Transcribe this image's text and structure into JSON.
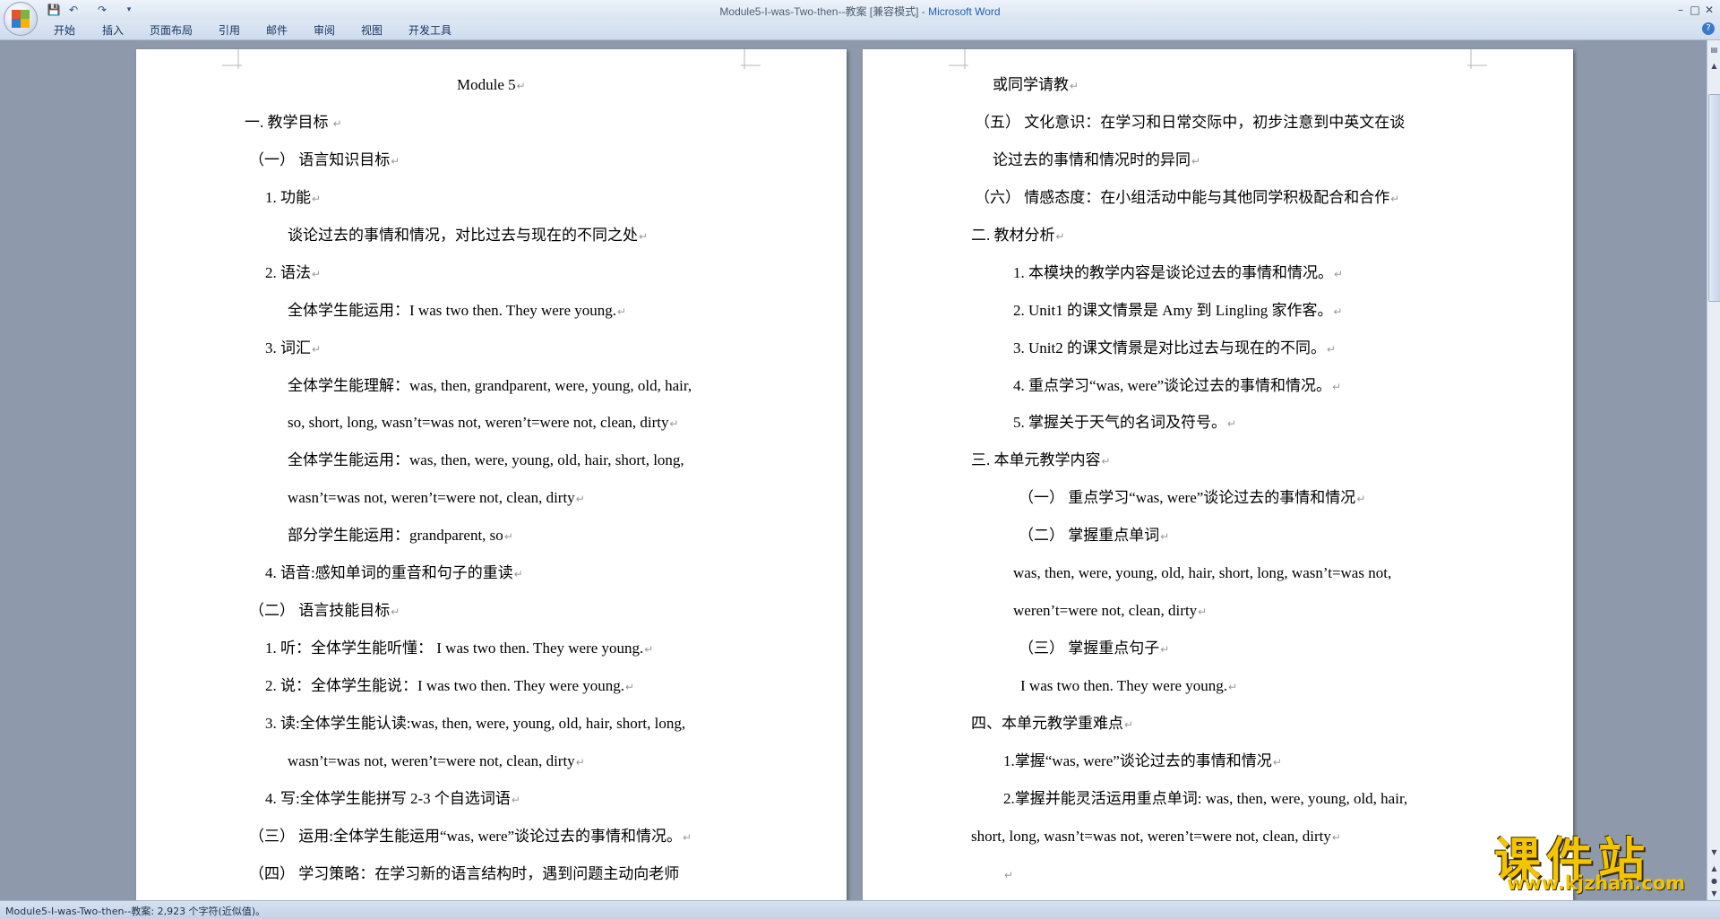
{
  "window": {
    "title": "Module5-I-was-Two-then--教案 [兼容模式] - ",
    "app_name": "Microsoft Word"
  },
  "ribbon": {
    "tabs": [
      "开始",
      "插入",
      "页面布局",
      "引用",
      "邮件",
      "审阅",
      "视图",
      "开发工具"
    ]
  },
  "icons": {
    "office_button": "office-logo-icon",
    "save": "save-icon",
    "undo": "undo-icon",
    "redo": "redo-icon",
    "customize": "dropdown-icon",
    "help": "help-icon",
    "paragraph_mark": "↵"
  },
  "colors": {
    "ribbon_bg": "#dde7f4",
    "workspace_bg": "#8e9aab",
    "title_app": "#1f5fb0",
    "watermark": "#f3c400"
  },
  "page1": {
    "lines": [
      "Module 5",
      "一.    教学目标    ",
      "（一）    语言知识目标",
      "1.  功能",
      "谈论过去的事情和情况，对比过去与现在的不同之处",
      "2.  语法",
      "全体学生能运用：I was two then. They were young.",
      "3.  词汇",
      "全体学生能理解：was, then, grandparent, were, young, old, hair,",
      "so, short, long, wasn’t=was not, weren’t=were not, clean, dirty",
      "全体学生能运用：was, then, were, young, old, hair, short, long,",
      "wasn’t=was not, weren’t=were not, clean, dirty",
      "部分学生能运用：grandparent, so",
      "4.  语音:感知单词的重音和句子的重读",
      "（二）    语言技能目标",
      "1.  听：全体学生能听懂： I was two then. They were young.",
      "2.  说：全体学生能说：I was two then. They were young.",
      "3.  读:全体学生能认读:was, then, were, young, old, hair, short, long,",
      "wasn’t=was not, weren’t=were not, clean, dirty",
      "4.  写:全体学生能拼写 2-3 个自选词语",
      "（三）    运用:全体学生能运用“was, were”谈论过去的事情和情况。",
      "（四）    学习策略：在学习新的语言结构时，遇到问题主动向老师"
    ]
  },
  "page2": {
    "lines": [
      "或同学请教",
      "（五）    文化意识：在学习和日常交际中，初步注意到中英文在谈",
      "论过去的事情和情况时的异同",
      "（六）    情感态度：在小组活动中能与其他同学积极配合和合作",
      "二.    教材分析",
      "1. 本模块的教学内容是谈论过去的事情和情况。",
      "2. Unit1 的课文情景是 Amy 到 Lingling 家作客。",
      "3. Unit2 的课文情景是对比过去与现在的不同。",
      "4. 重点学习“was, were”谈论过去的事情和情况。",
      "5. 掌握关于天气的名词及符号。",
      "三.    本单元教学内容",
      "（一）  重点学习“was, were”谈论过去的事情和情况",
      "（二）  掌握重点单词",
      "was, then, were, young, old, hair, short, long, wasn’t=was not,",
      "weren’t=were not, clean, dirty",
      "（三）  掌握重点句子",
      "I was two then. They were young.",
      "四、本单元教学重难点",
      "1.掌握“was, were”谈论过去的事情和情况",
      "2.掌握并能灵活运用重点单词: was, then, were, young, old, hair,",
      "short, long, wasn’t=was not, weren’t=were not, clean, dirty",
      ""
    ]
  },
  "status": {
    "text": "Module5-I-was-Two-then--教案: 2,923 个字符(近似值)。"
  },
  "watermark": {
    "big": "课件站",
    "url": "www.kjzhan.com"
  }
}
